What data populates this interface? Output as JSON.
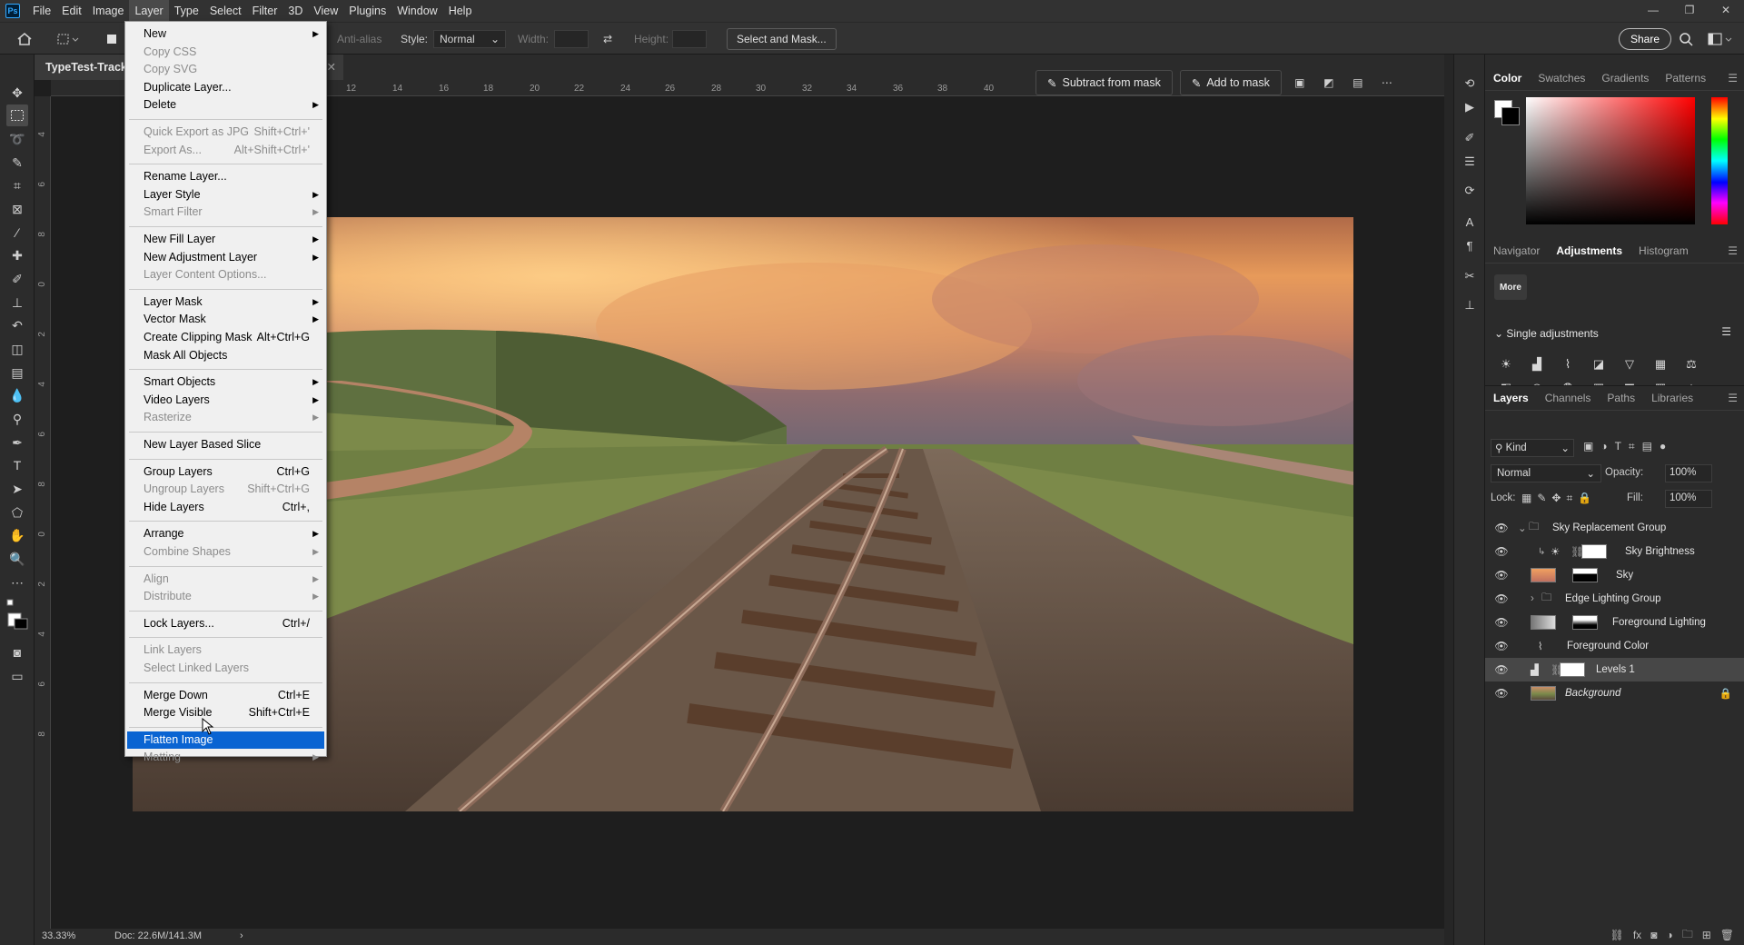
{
  "menubar": {
    "logo": "Ps",
    "items": [
      "File",
      "Edit",
      "Image",
      "Layer",
      "Type",
      "Select",
      "Filter",
      "3D",
      "View",
      "Plugins",
      "Window",
      "Help"
    ],
    "active": "Layer"
  },
  "window_controls": {
    "minimize": "—",
    "restore": "❐",
    "close": "✕"
  },
  "options": {
    "antialias": "Anti-alias",
    "style_label": "Style:",
    "style_value": "Normal",
    "width_label": "Width:",
    "height_label": "Height:",
    "select_mask": "Select and Mask...",
    "share": "Share"
  },
  "document": {
    "tab_title": "TypeTest-Track",
    "zoom": "33.33%",
    "doc_size": "Doc: 22.6M/141.3M"
  },
  "ruler": {
    "top": [
      "10",
      "12",
      "14",
      "16",
      "18",
      "20",
      "22",
      "24",
      "26",
      "28",
      "30",
      "32",
      "34",
      "36",
      "38",
      "40"
    ],
    "left": [
      "4",
      "6",
      "8",
      "0",
      "2",
      "4",
      "6",
      "8",
      "0",
      "2",
      "4",
      "6",
      "8"
    ]
  },
  "mask_toolbar": {
    "subtract": "Subtract from mask",
    "add": "Add to mask"
  },
  "layer_menu": {
    "items": [
      {
        "label": "New",
        "shortcut": "",
        "submenu": true,
        "disabled": false
      },
      {
        "label": "Copy CSS",
        "shortcut": "",
        "submenu": false,
        "disabled": true
      },
      {
        "label": "Copy SVG",
        "shortcut": "",
        "submenu": false,
        "disabled": true
      },
      {
        "label": "Duplicate Layer...",
        "shortcut": "",
        "submenu": false,
        "disabled": false
      },
      {
        "label": "Delete",
        "shortcut": "",
        "submenu": true,
        "disabled": false
      },
      {
        "label": "Quick Export as JPG",
        "shortcut": "Shift+Ctrl+'",
        "submenu": false,
        "disabled": true
      },
      {
        "label": "Export As...",
        "shortcut": "Alt+Shift+Ctrl+'",
        "submenu": false,
        "disabled": true
      },
      {
        "label": "Rename Layer...",
        "shortcut": "",
        "submenu": false,
        "disabled": false
      },
      {
        "label": "Layer Style",
        "shortcut": "",
        "submenu": true,
        "disabled": false
      },
      {
        "label": "Smart Filter",
        "shortcut": "",
        "submenu": true,
        "disabled": true
      },
      {
        "label": "New Fill Layer",
        "shortcut": "",
        "submenu": true,
        "disabled": false
      },
      {
        "label": "New Adjustment Layer",
        "shortcut": "",
        "submenu": true,
        "disabled": false
      },
      {
        "label": "Layer Content Options...",
        "shortcut": "",
        "submenu": false,
        "disabled": true
      },
      {
        "label": "Layer Mask",
        "shortcut": "",
        "submenu": true,
        "disabled": false
      },
      {
        "label": "Vector Mask",
        "shortcut": "",
        "submenu": true,
        "disabled": false
      },
      {
        "label": "Create Clipping Mask",
        "shortcut": "Alt+Ctrl+G",
        "submenu": false,
        "disabled": false
      },
      {
        "label": "Mask All Objects",
        "shortcut": "",
        "submenu": false,
        "disabled": false
      },
      {
        "label": "Smart Objects",
        "shortcut": "",
        "submenu": true,
        "disabled": false
      },
      {
        "label": "Video Layers",
        "shortcut": "",
        "submenu": true,
        "disabled": false
      },
      {
        "label": "Rasterize",
        "shortcut": "",
        "submenu": true,
        "disabled": true
      },
      {
        "label": "New Layer Based Slice",
        "shortcut": "",
        "submenu": false,
        "disabled": false
      },
      {
        "label": "Group Layers",
        "shortcut": "Ctrl+G",
        "submenu": false,
        "disabled": false
      },
      {
        "label": "Ungroup Layers",
        "shortcut": "Shift+Ctrl+G",
        "submenu": false,
        "disabled": true
      },
      {
        "label": "Hide Layers",
        "shortcut": "Ctrl+,",
        "submenu": false,
        "disabled": false
      },
      {
        "label": "Arrange",
        "shortcut": "",
        "submenu": true,
        "disabled": false
      },
      {
        "label": "Combine Shapes",
        "shortcut": "",
        "submenu": true,
        "disabled": true
      },
      {
        "label": "Align",
        "shortcut": "",
        "submenu": true,
        "disabled": true
      },
      {
        "label": "Distribute",
        "shortcut": "",
        "submenu": true,
        "disabled": true
      },
      {
        "label": "Lock Layers...",
        "shortcut": "Ctrl+/",
        "submenu": false,
        "disabled": false
      },
      {
        "label": "Link Layers",
        "shortcut": "",
        "submenu": false,
        "disabled": true
      },
      {
        "label": "Select Linked Layers",
        "shortcut": "",
        "submenu": false,
        "disabled": true
      },
      {
        "label": "Merge Down",
        "shortcut": "Ctrl+E",
        "submenu": false,
        "disabled": false
      },
      {
        "label": "Merge Visible",
        "shortcut": "Shift+Ctrl+E",
        "submenu": false,
        "disabled": false
      },
      {
        "label": "Flatten Image",
        "shortcut": "",
        "submenu": false,
        "disabled": false,
        "highlighted": true
      },
      {
        "label": "Matting",
        "shortcut": "",
        "submenu": true,
        "disabled": true
      }
    ]
  },
  "color_panel": {
    "tabs": [
      "Color",
      "Swatches",
      "Gradients",
      "Patterns"
    ],
    "active": "Color",
    "fg": "#ffffff",
    "bg": "#000000"
  },
  "adjustments_panel": {
    "tabs": [
      "Navigator",
      "Adjustments",
      "Histogram"
    ],
    "active": "Adjustments",
    "more": "More",
    "section": "Single adjustments",
    "icons": [
      "brightness-icon",
      "levels-icon",
      "curves-icon",
      "exposure-icon",
      "vibrance-icon",
      "hue-saturation-icon",
      "color-balance-icon",
      "black-white-icon",
      "photo-filter-icon",
      "channel-mixer-icon",
      "color-lookup-icon",
      "invert-icon",
      "posterize-icon",
      "threshold-icon"
    ]
  },
  "layers_panel": {
    "tabs": [
      "Layers",
      "Channels",
      "Paths",
      "Libraries"
    ],
    "active": "Layers",
    "filter": "Kind",
    "blend_mode": "Normal",
    "opacity_label": "Opacity:",
    "opacity": "100%",
    "lock_label": "Lock:",
    "fill_label": "Fill:",
    "fill": "100%",
    "layers": [
      {
        "name": "Sky Replacement Group",
        "type": "group"
      },
      {
        "name": "Sky Brightness",
        "type": "adjust"
      },
      {
        "name": "Sky",
        "type": "image"
      },
      {
        "name": "Edge Lighting Group",
        "type": "group"
      },
      {
        "name": "Foreground Lighting",
        "type": "image"
      },
      {
        "name": "Foreground Color",
        "type": "adjust"
      },
      {
        "name": "Levels 1",
        "type": "adjust",
        "selected": true
      },
      {
        "name": "Background",
        "type": "image",
        "locked": true
      }
    ]
  }
}
